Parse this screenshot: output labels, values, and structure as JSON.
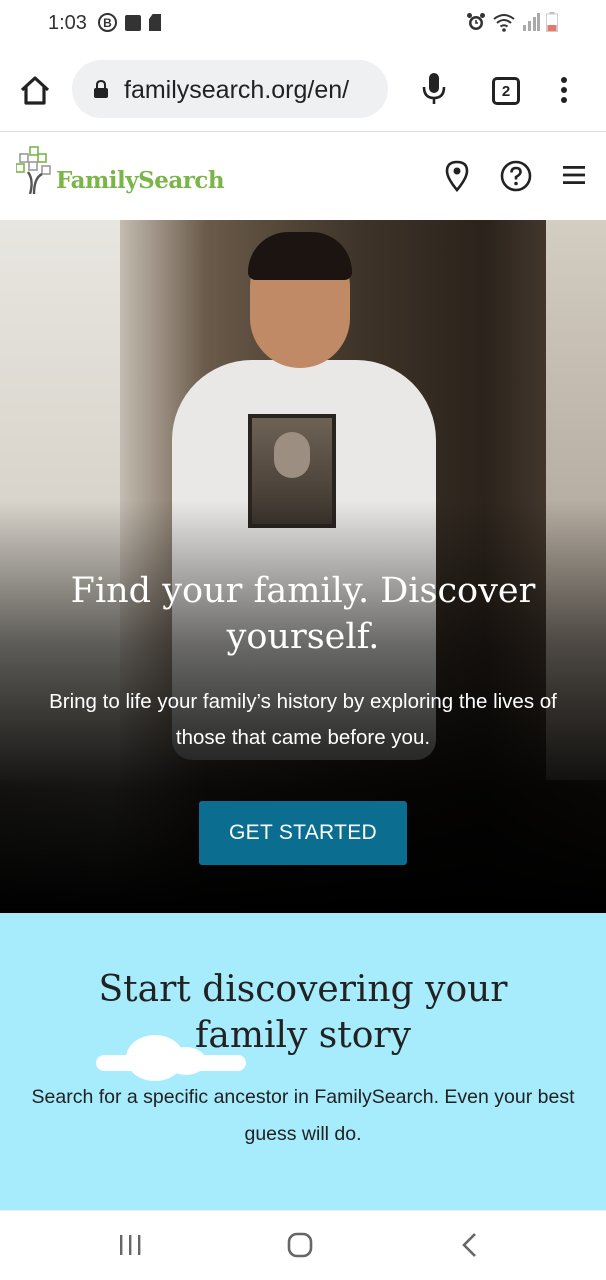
{
  "status_bar": {
    "time": "1:03",
    "b_badge": "B",
    "icons": [
      "b-circle-icon",
      "image-icon",
      "sd-card-icon",
      "alarm-icon",
      "wifi-icon",
      "signal-icon",
      "battery-low-icon"
    ],
    "battery_color": "#e8756b"
  },
  "browser": {
    "url": "familysearch.org/en/",
    "tab_count": "2",
    "icons": [
      "home-icon",
      "lock-icon",
      "mic-icon",
      "tabs-icon",
      "more-vert-icon"
    ]
  },
  "site_header": {
    "logo_text": "FamilySearch",
    "logo_color": "#7ab547",
    "icons": [
      "location-pin-icon",
      "help-icon",
      "hamburger-menu-icon"
    ]
  },
  "hero": {
    "title": "Find your family. Discover yourself.",
    "subtitle": "Bring to life your family’s history by exploring the lives of those that came before you.",
    "cta_label": "GET STARTED",
    "cta_color": "#0b6e90"
  },
  "discover": {
    "title": "Start discovering your family story",
    "text": "Search for a specific ancestor in FamilySearch. Even your best guess will do.",
    "background": "#a6ecfc"
  },
  "nav_bar": {
    "icons": [
      "recent-apps-icon",
      "home-nav-icon",
      "back-icon"
    ]
  }
}
